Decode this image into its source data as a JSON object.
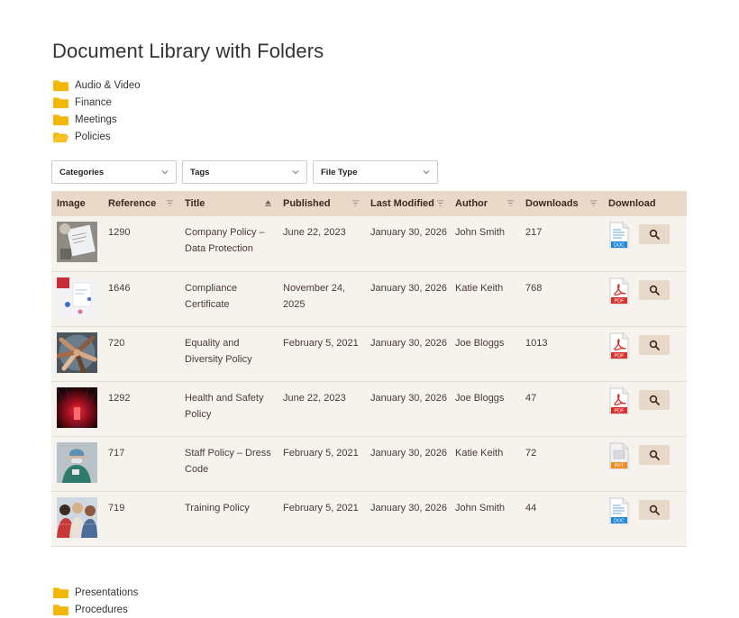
{
  "page": {
    "title": "Document Library with Folders"
  },
  "folders_top": [
    {
      "label": "Audio & Video",
      "open": false
    },
    {
      "label": "Finance",
      "open": false
    },
    {
      "label": "Meetings",
      "open": false
    },
    {
      "label": "Policies",
      "open": true
    }
  ],
  "filters": [
    {
      "label": "Categories"
    },
    {
      "label": "Tags"
    },
    {
      "label": "File Type"
    }
  ],
  "table": {
    "headers": {
      "image": "Image",
      "reference": "Reference",
      "title": "Title",
      "published": "Published",
      "last_modified": "Last Modified",
      "author": "Author",
      "downloads": "Downloads",
      "download": "Download"
    },
    "rows": [
      {
        "reference": "1290",
        "title": "Company Policy – Data Protection",
        "published": "June 22, 2023",
        "last_modified": "January 30, 2026",
        "author": "John Smith",
        "downloads": "217",
        "file_type": "DOC",
        "thumb": "papers"
      },
      {
        "reference": "1646",
        "title": "Compliance Certificate",
        "published": "November 24, 2025",
        "last_modified": "January 30, 2026",
        "author": "Katie Keith",
        "downloads": "768",
        "file_type": "PDF",
        "thumb": "desk"
      },
      {
        "reference": "720",
        "title": "Equality and Diversity Policy",
        "published": "February 5, 2021",
        "last_modified": "January 30, 2026",
        "author": "Joe Bloggs",
        "downloads": "1013",
        "file_type": "PDF",
        "thumb": "hands"
      },
      {
        "reference": "1292",
        "title": "Health and Safety Policy",
        "published": "June 22, 2023",
        "last_modified": "January 30, 2026",
        "author": "Joe Bloggs",
        "downloads": "47",
        "file_type": "PDF",
        "thumb": "red-light"
      },
      {
        "reference": "717",
        "title": "Staff Policy – Dress Code",
        "published": "February 5, 2021",
        "last_modified": "January 30, 2026",
        "author": "Katie Keith",
        "downloads": "72",
        "file_type": "PPT",
        "thumb": "worker"
      },
      {
        "reference": "719",
        "title": "Training Policy",
        "published": "February 5, 2021",
        "last_modified": "January 30, 2026",
        "author": "John Smith",
        "downloads": "44",
        "file_type": "DOC",
        "thumb": "group"
      }
    ]
  },
  "folders_bottom": [
    {
      "label": "Presentations",
      "open": false
    },
    {
      "label": "Procedures",
      "open": false
    }
  ],
  "colors": {
    "folder": "#f2b705",
    "header_bg": "#e9d9c9",
    "row_bg": "#f6f3ef",
    "pdf": "#d9302c",
    "doc": "#1e88d8",
    "ppt": "#f08a24"
  },
  "icons": {
    "folder": "folder-icon",
    "folder_open": "folder-open-icon",
    "sort": "sort-icon",
    "chevron": "chevron-down-icon",
    "view": "magnifier-icon"
  }
}
